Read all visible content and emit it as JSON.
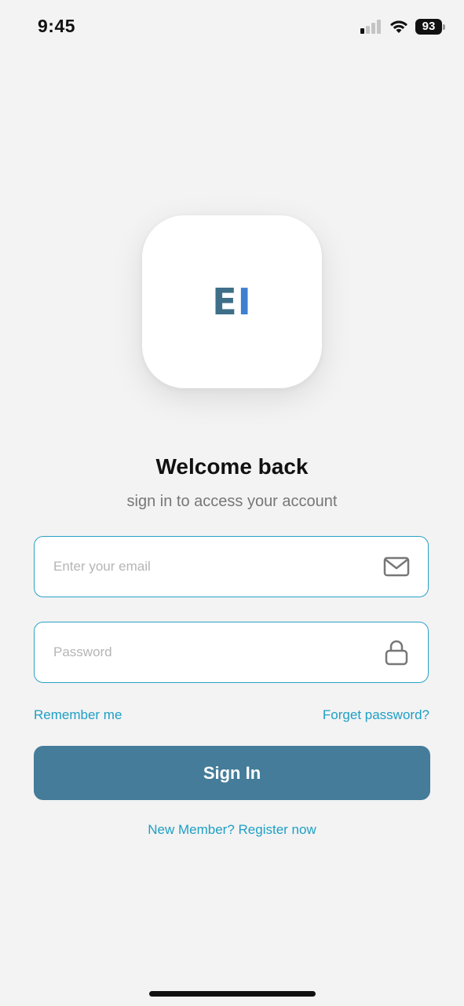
{
  "status_bar": {
    "time": "9:45",
    "battery": "93"
  },
  "logo": {
    "letter_e": "E",
    "letter_i": "I",
    "colors": {
      "e": "#3f6f88",
      "i": "#3f7fd0"
    }
  },
  "header": {
    "title": "Welcome back",
    "subtitle": "sign in to access your account"
  },
  "form": {
    "email_placeholder": "Enter your email",
    "email_icon": "envelope-icon",
    "password_placeholder": "Password",
    "password_icon": "lock-icon",
    "remember_label": "Remember me",
    "forgot_label": "Forget password?",
    "submit_label": "Sign In"
  },
  "footer": {
    "register_label": "New Member? Register now"
  },
  "colors": {
    "accent": "#1e9fc4",
    "button": "#447c99",
    "background": "#f3f3f3"
  }
}
